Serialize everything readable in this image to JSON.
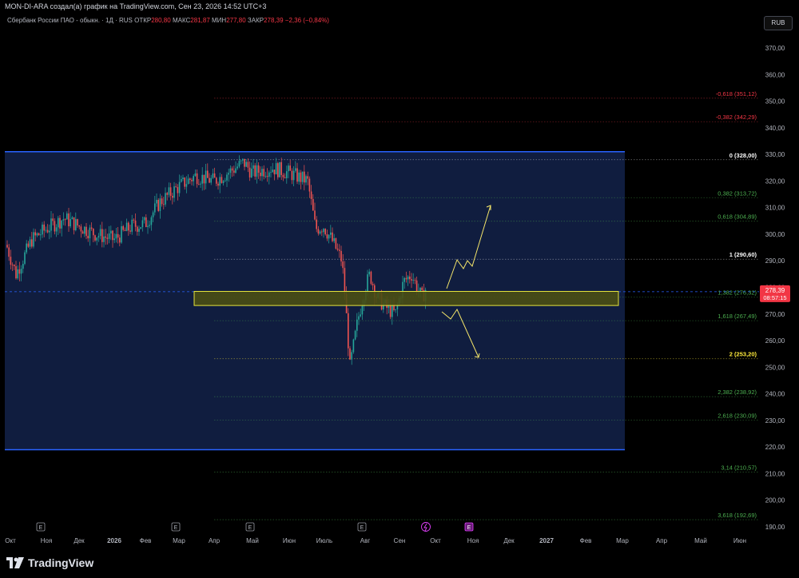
{
  "header": {
    "author_line": "MON-DI-ARA создал(а) график на TradingView.com, Сен 23, 2026 14:52 UTC+3"
  },
  "legend": {
    "symbol": "Сбербанк России ПАО - обыкн. · 1Д · RUS",
    "open_label": "ОТКР",
    "open": "280,80",
    "high_label": "МАКС",
    "high": "281,87",
    "low_label": "МИН",
    "low": "277,80",
    "close_label": "ЗАКР",
    "close": "278,39",
    "change": "−2,36 (−0,84%)"
  },
  "currency_button": "RUB",
  "brand": "TradingView",
  "colors": {
    "up": "#26a69a",
    "down": "#ef5350",
    "box_fill": "#13224a",
    "box_border": "#2962ff",
    "zone": "#4a4f14",
    "zone_border": "#e6e33a",
    "arrow": "#f5e66a",
    "fib_red": "#f23645",
    "fib_green": "#4caf50",
    "fib_white": "#ffffff",
    "fib_yellow": "#ffeb3b"
  },
  "chart_data": {
    "type": "candlestick",
    "symbol": "SBER",
    "currency": "RUB",
    "y_ticks": [
      "370,00",
      "360,00",
      "350,00",
      "340,00",
      "330,00",
      "320,00",
      "310,00",
      "300,00",
      "290,00",
      "280,00",
      "270,00",
      "260,00",
      "250,00",
      "240,00",
      "230,00",
      "220,00",
      "210,00",
      "200,00",
      "190,00"
    ],
    "ylim": [
      187,
      377
    ],
    "x_ticks": [
      "Окт",
      "Ноя",
      "Дек",
      "2026",
      "Фев",
      "Мар",
      "Апр",
      "Май",
      "Июн",
      "Июль",
      "Авг",
      "Сен",
      "Окт",
      "Ноя",
      "Дек",
      "2027",
      "Фев",
      "Мар",
      "Апр",
      "Май",
      "Июн"
    ],
    "last_price": "278,39",
    "countdown": "08:57:15",
    "fib_levels": [
      {
        "ratio": "-0,618",
        "price": "351,12",
        "value": 351.12,
        "color": "#f23645"
      },
      {
        "ratio": "-0,382",
        "price": "342,29",
        "value": 342.29,
        "color": "#f23645"
      },
      {
        "ratio": "0",
        "price": "328,00",
        "value": 328.0,
        "color": "#ffffff"
      },
      {
        "ratio": "0,382",
        "price": "313,72",
        "value": 313.72,
        "color": "#4caf50"
      },
      {
        "ratio": "0,618",
        "price": "304,89",
        "value": 304.89,
        "color": "#4caf50"
      },
      {
        "ratio": "1",
        "price": "290,60",
        "value": 290.6,
        "color": "#ffffff"
      },
      {
        "ratio": "1,382",
        "price": "276,32",
        "value": 276.32,
        "color": "#4caf50"
      },
      {
        "ratio": "1,618",
        "price": "267,49",
        "value": 267.49,
        "color": "#4caf50"
      },
      {
        "ratio": "2",
        "price": "253,20",
        "value": 253.2,
        "color": "#ffeb3b"
      },
      {
        "ratio": "2,382",
        "price": "238,92",
        "value": 238.92,
        "color": "#4caf50"
      },
      {
        "ratio": "2,618",
        "price": "230,09",
        "value": 230.09,
        "color": "#4caf50"
      },
      {
        "ratio": "3,14",
        "price": "210,57",
        "value": 210.57,
        "color": "#4caf50"
      },
      {
        "ratio": "3,618",
        "price": "192,69",
        "value": 192.69,
        "color": "#4caf50"
      }
    ],
    "range_box": {
      "top": 331,
      "bottom": 219
    },
    "zone": {
      "top": 278.5,
      "bottom": 273.2
    },
    "dashed_price_line": 278.39,
    "price_path": [
      {
        "month": "Окт",
        "close": 287
      },
      {
        "month": "Ноя",
        "close": 302
      },
      {
        "month": "Дек",
        "close": 303
      },
      {
        "month": "2026",
        "close": 298
      },
      {
        "month": "Фев",
        "close": 303
      },
      {
        "month": "Мар",
        "close": 318
      },
      {
        "month": "Апр",
        "close": 321
      },
      {
        "month": "Май",
        "close": 324
      },
      {
        "month": "Июн",
        "close": 323
      },
      {
        "month": "Июль",
        "close": 292
      },
      {
        "month": "Авг",
        "close": 275
      },
      {
        "month": "Сен",
        "close": 278.39
      }
    ],
    "event_markers": [
      "E",
      "E",
      "E",
      "E",
      "E"
    ]
  }
}
